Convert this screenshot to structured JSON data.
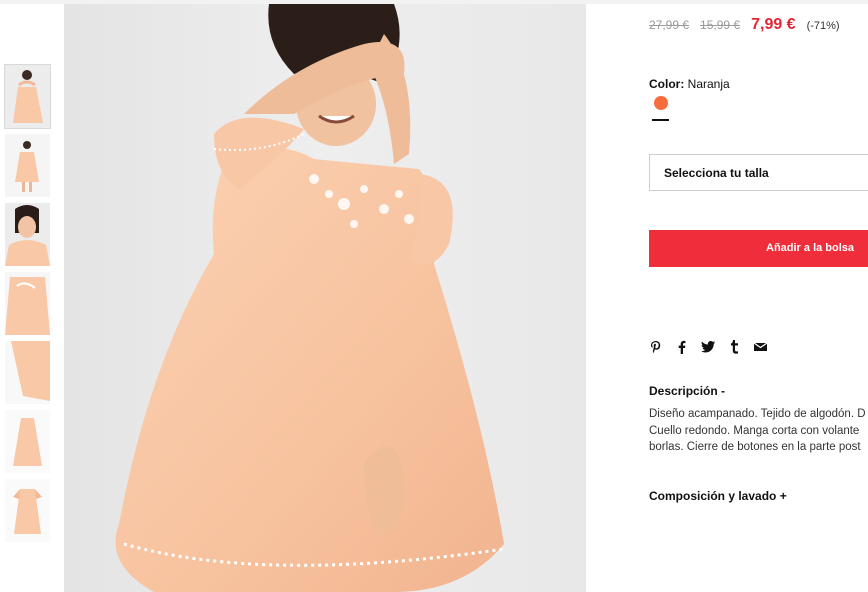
{
  "product": {
    "prices": {
      "original": "27,99 €",
      "previous": "15,99 €",
      "current": "7,99 €",
      "discount": "(-71%)"
    },
    "color": {
      "label": "Color:",
      "value": "Naranja",
      "swatch_color": "#f86c3c"
    },
    "size_select": {
      "placeholder": "Selecciona tu talla"
    },
    "add_to_bag": "Añadir a la bolsa",
    "share_icons": [
      "pinterest-icon",
      "facebook-icon",
      "twitter-icon",
      "tumblr-icon",
      "email-icon"
    ],
    "description": {
      "heading": "Descripción -",
      "lines": [
        "Diseño acampanado. Tejido de algodón. D",
        "Cuello redondo. Manga corta con volante",
        "borlas. Cierre de botones en la parte post"
      ]
    },
    "composition": {
      "heading": "Composición y lavado +"
    }
  },
  "gallery": {
    "thumbnail_count": 7,
    "active_index": 0,
    "dress_color": "#f9c8a6",
    "background_color": "#ececec"
  },
  "colors": {
    "accent_red": "#f02d3b",
    "price_red": "#e32636"
  }
}
